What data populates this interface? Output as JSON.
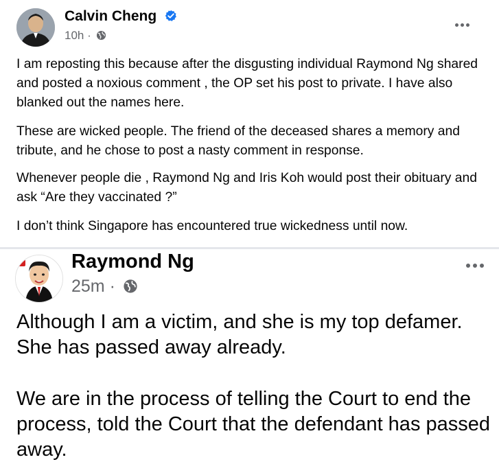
{
  "post_main": {
    "author": "Calvin Cheng",
    "verified": true,
    "timestamp": "10h",
    "separator": "·",
    "privacy_icon": "globe-icon",
    "more_icon": "more-options-icon",
    "paragraphs": [
      "I am reposting this because after the disgusting individual Raymond Ng shared and posted a noxious comment , the OP set his post to private. I have also blanked out the names here.",
      "These are wicked people. The friend of the deceased shares a memory and tribute, and he chose to post a nasty comment in response.",
      "Whenever people die , Raymond Ng and Iris Koh would post their obituary and ask “Are they vaccinated ?”",
      "I don’t think Singapore has encountered true wickedness until now."
    ]
  },
  "post_shared": {
    "author": "Raymond Ng",
    "timestamp": "25m",
    "separator": "·",
    "privacy_icon": "globe-icon",
    "more_icon": "more-options-icon",
    "paragraphs": [
      "Although I am a victim, and she is my top defamer. She has passed away already.",
      "We are in the process of telling the Court to end the process, told the Court that the defendant has passed away."
    ]
  },
  "colors": {
    "text": "#050505",
    "meta": "#65676b",
    "verified_badge": "#1877f2",
    "divider": "#e4e6eb"
  }
}
